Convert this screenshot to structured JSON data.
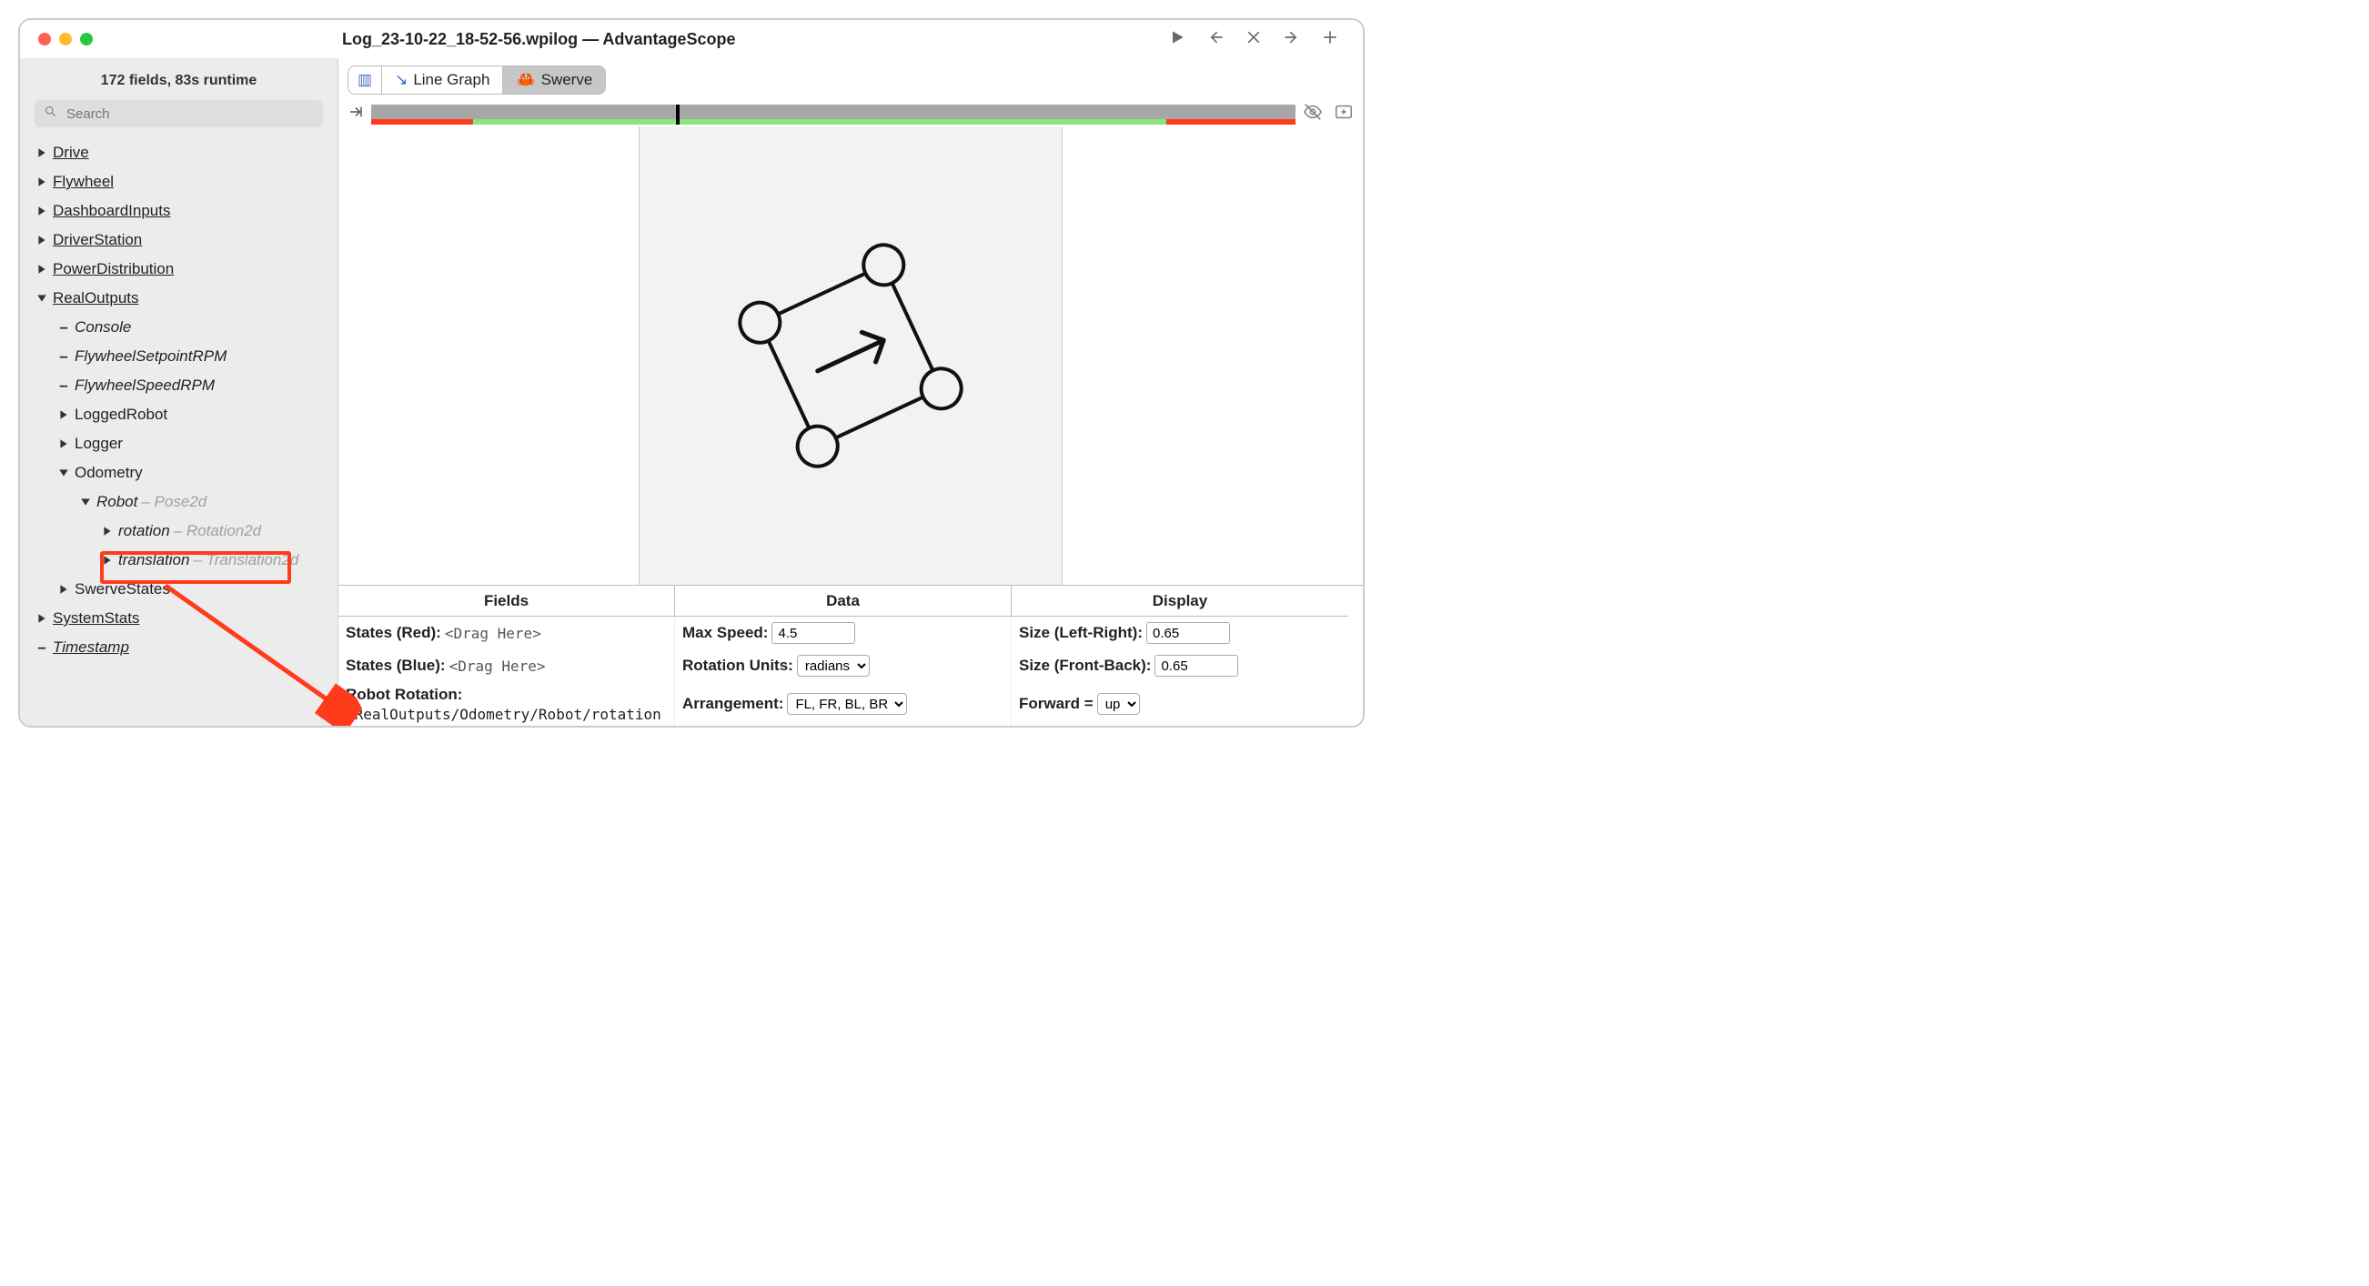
{
  "title": "Log_23-10-22_18-52-56.wpilog — AdvantageScope",
  "sidebar": {
    "summary": "172 fields, 83s runtime",
    "search_placeholder": "Search"
  },
  "tree": {
    "drive": "Drive",
    "flywheel": "Flywheel",
    "dashboardInputs": "DashboardInputs",
    "driverStation": "DriverStation",
    "powerDistribution": "PowerDistribution",
    "realOutputs": "RealOutputs",
    "console": "Console",
    "fwSetpoint": "FlywheelSetpointRPM",
    "fwSpeed": "FlywheelSpeedRPM",
    "loggedRobot": "LoggedRobot",
    "logger": "Logger",
    "odometry": "Odometry",
    "robot": "Robot",
    "robot_type": " – Pose2d",
    "rotation": "rotation",
    "rotation_type": " – Rotation2d",
    "translation": "translation",
    "translation_type": " – Translation2d",
    "swerveStates": "SwerveStates",
    "systemStats": "SystemStats",
    "timestamp": "Timestamp"
  },
  "tabs": {
    "lineGraph": "Line Graph",
    "swerve": "Swerve"
  },
  "icons": {
    "book": "📖",
    "chart": "📈",
    "crab": "🦀"
  },
  "config": {
    "headers": {
      "fields": "Fields",
      "data": "Data",
      "display": "Display"
    },
    "fields": {
      "statesRed_label": "States (Red): ",
      "statesBlue_label": "States (Blue): ",
      "drag_here": "<Drag Here>",
      "robotRotation_label": "Robot Rotation:",
      "robotRotation_value": "/RealOutputs/Odometry/Robot/rotation"
    },
    "data": {
      "maxSpeed_label": "Max Speed: ",
      "maxSpeed_value": "4.5",
      "rotationUnits_label": "Rotation Units: ",
      "rotationUnits_value": "radians",
      "arrangement_label": "Arrangement: ",
      "arrangement_value": "FL, FR, BL, BR"
    },
    "display": {
      "sizeLR_label": "Size (Left-Right): ",
      "sizeLR_value": "0.65",
      "sizeFB_label": "Size (Front-Back): ",
      "sizeFB_value": "0.65",
      "forward_label": "Forward = ",
      "forward_value": "up"
    }
  }
}
